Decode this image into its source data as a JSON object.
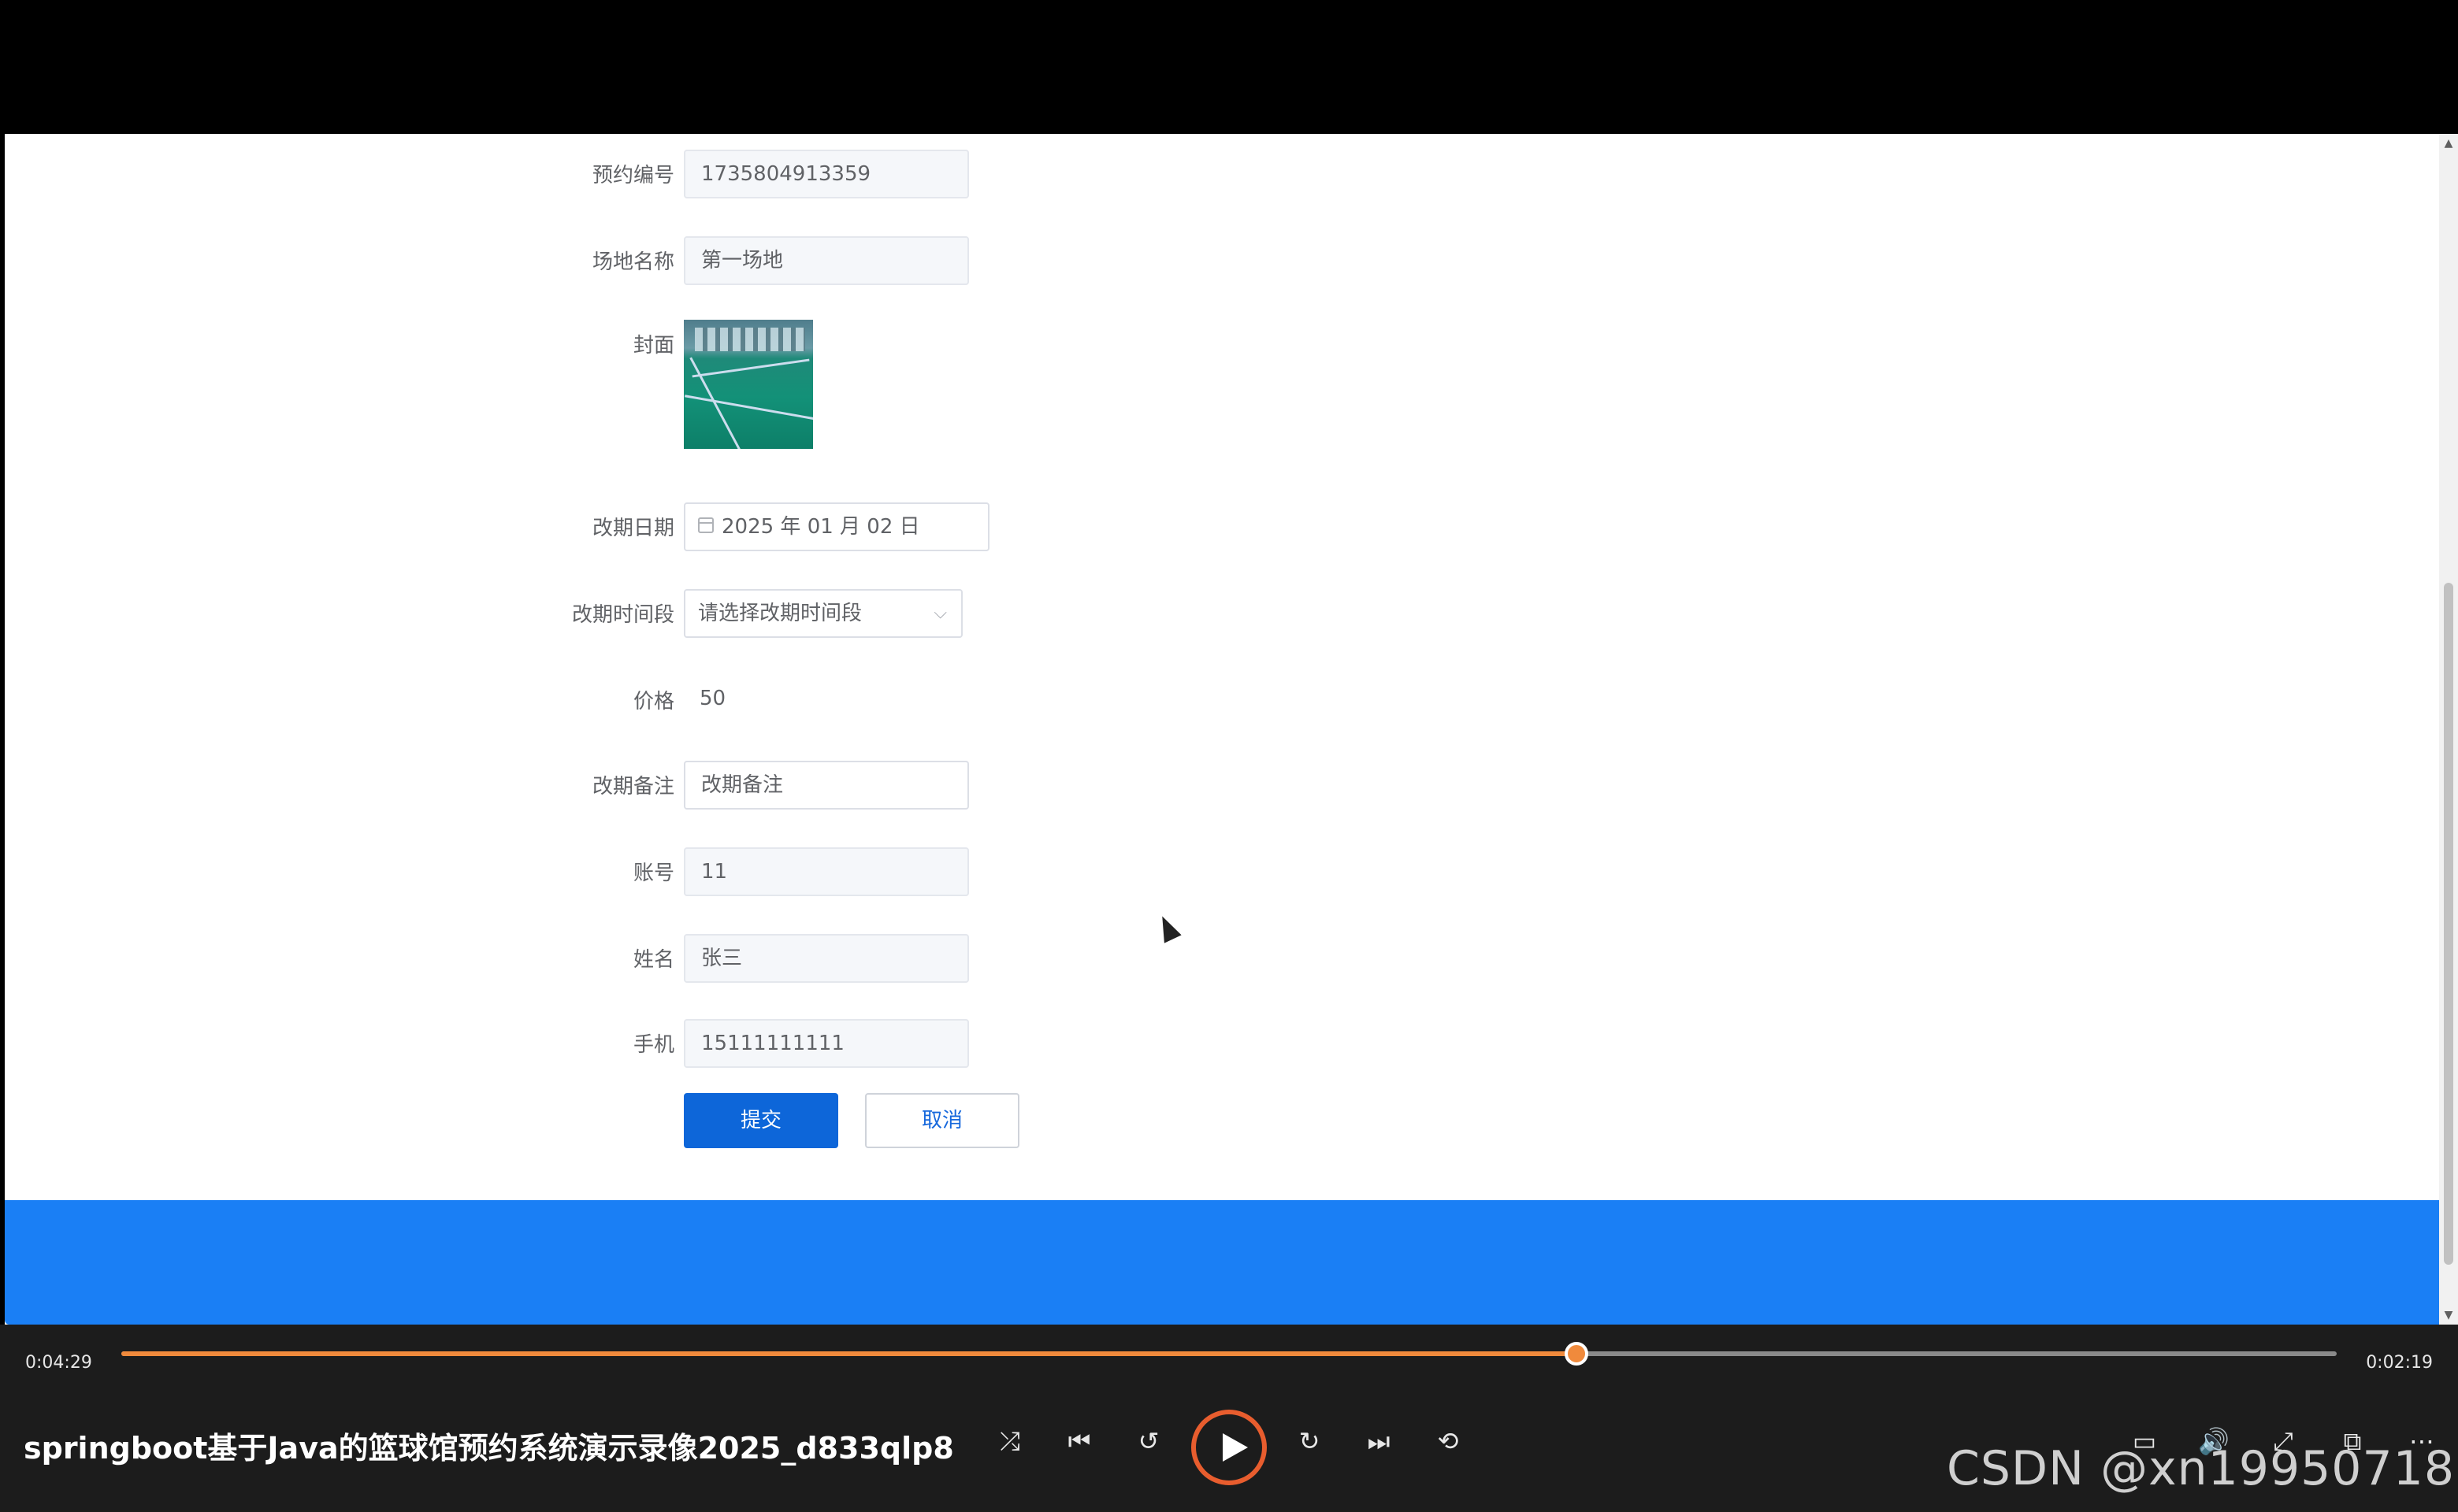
{
  "form": {
    "booking_no": {
      "label": "预约编号",
      "value": "1735804913359"
    },
    "venue_name": {
      "label": "场地名称",
      "value": "第一场地"
    },
    "cover": {
      "label": "封面"
    },
    "reschedule_date": {
      "label": "改期日期",
      "value": "2025 年 01 月 02 日"
    },
    "reschedule_slot": {
      "label": "改期时间段",
      "placeholder": "请选择改期时间段"
    },
    "price": {
      "label": "价格",
      "value": "50"
    },
    "reschedule_note": {
      "label": "改期备注",
      "placeholder": "改期备注"
    },
    "account": {
      "label": "账号",
      "value": "11"
    },
    "name": {
      "label": "姓名",
      "value": "张三"
    },
    "phone": {
      "label": "手机",
      "value": "15111111111"
    },
    "submit_label": "提交",
    "cancel_label": "取消"
  },
  "player": {
    "elapsed": "0:04:29",
    "remaining": "0:02:19",
    "progress_fraction": 0.657,
    "title": "springboot基于Java的篮球馆预约系统演示录像2025_d833qlp8",
    "accent": "#f08a3c"
  },
  "icons": {
    "shuffle": "⤮",
    "prev": "⏮",
    "back10": "↺",
    "fwd30": "↻",
    "next": "⏭",
    "repeat": "⟲",
    "subtitles": "▭",
    "volume": "🔊",
    "expand": "⤢",
    "miniplayer": "⧉",
    "more": "⋯"
  },
  "watermark": "CSDN @xn19950718"
}
